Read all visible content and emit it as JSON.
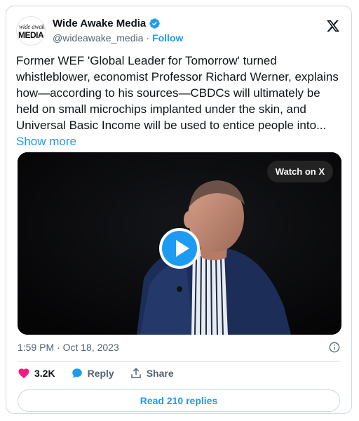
{
  "author": {
    "name": "Wide Awake Media",
    "handle": "@wideawake_media",
    "separator": "·",
    "follow_label": "Follow",
    "avatar_line1": "wide awake",
    "avatar_line2": "MEDIA"
  },
  "tweet": {
    "text": "Former WEF 'Global Leader for Tomorrow' turned whistleblower, economist Professor Richard Werner, explains how—according to his sources—CBDCs will ultimately be held on small microchips implanted under the skin, and Universal Basic Income will be used to entice people into...",
    "show_more": "Show more"
  },
  "media": {
    "watch_label": "Watch on X"
  },
  "meta": {
    "timestamp": "1:59 PM · Oct 18, 2023"
  },
  "actions": {
    "likes": "3.2K",
    "reply_label": "Reply",
    "share_label": "Share"
  },
  "read_replies": "Read 210 replies",
  "colors": {
    "accent": "#1d9bf0",
    "like": "#f91880",
    "text": "#0f1419",
    "muted": "#536471"
  }
}
